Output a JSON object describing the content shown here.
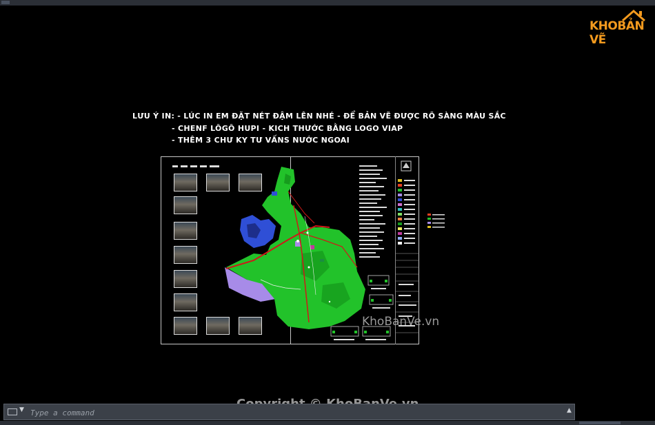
{
  "logo": {
    "part1": "KHO",
    "part2": "BẢN VẼ",
    "icon": "house-roof-icon"
  },
  "notes": {
    "line1": "LƯU Ý IN: - LÚC IN EM ĐẶT NÉT ĐẬM LÊN NHÉ - ĐỂ BẢN VẼ ĐƯỢC RÕ SÀNG MÀU SẮC",
    "line2": "- CHENF LÔGÔ HUPI - KICH THƯỚC BẰNG LOGO VIAP",
    "line3": "- THÊM 3 CHƯ KY TƯ VẤNS NƯỚC NGOAI"
  },
  "watermarks": {
    "middle": "KhoBanVe.vn",
    "bottom": "Copyright © KhoBanVe.vn"
  },
  "command_line": {
    "placeholder": "Type a command",
    "icon": "terminal-icon",
    "dropdown_icon": "caret-down-icon",
    "history_icon": "caret-up-icon"
  },
  "colors": {
    "background": "#000000",
    "map_green": "#22c22a",
    "map_blue": "#2f4fd6",
    "map_purple": "#a78be8",
    "road_red": "#d01818",
    "logo_orange": "#f39a1e"
  }
}
